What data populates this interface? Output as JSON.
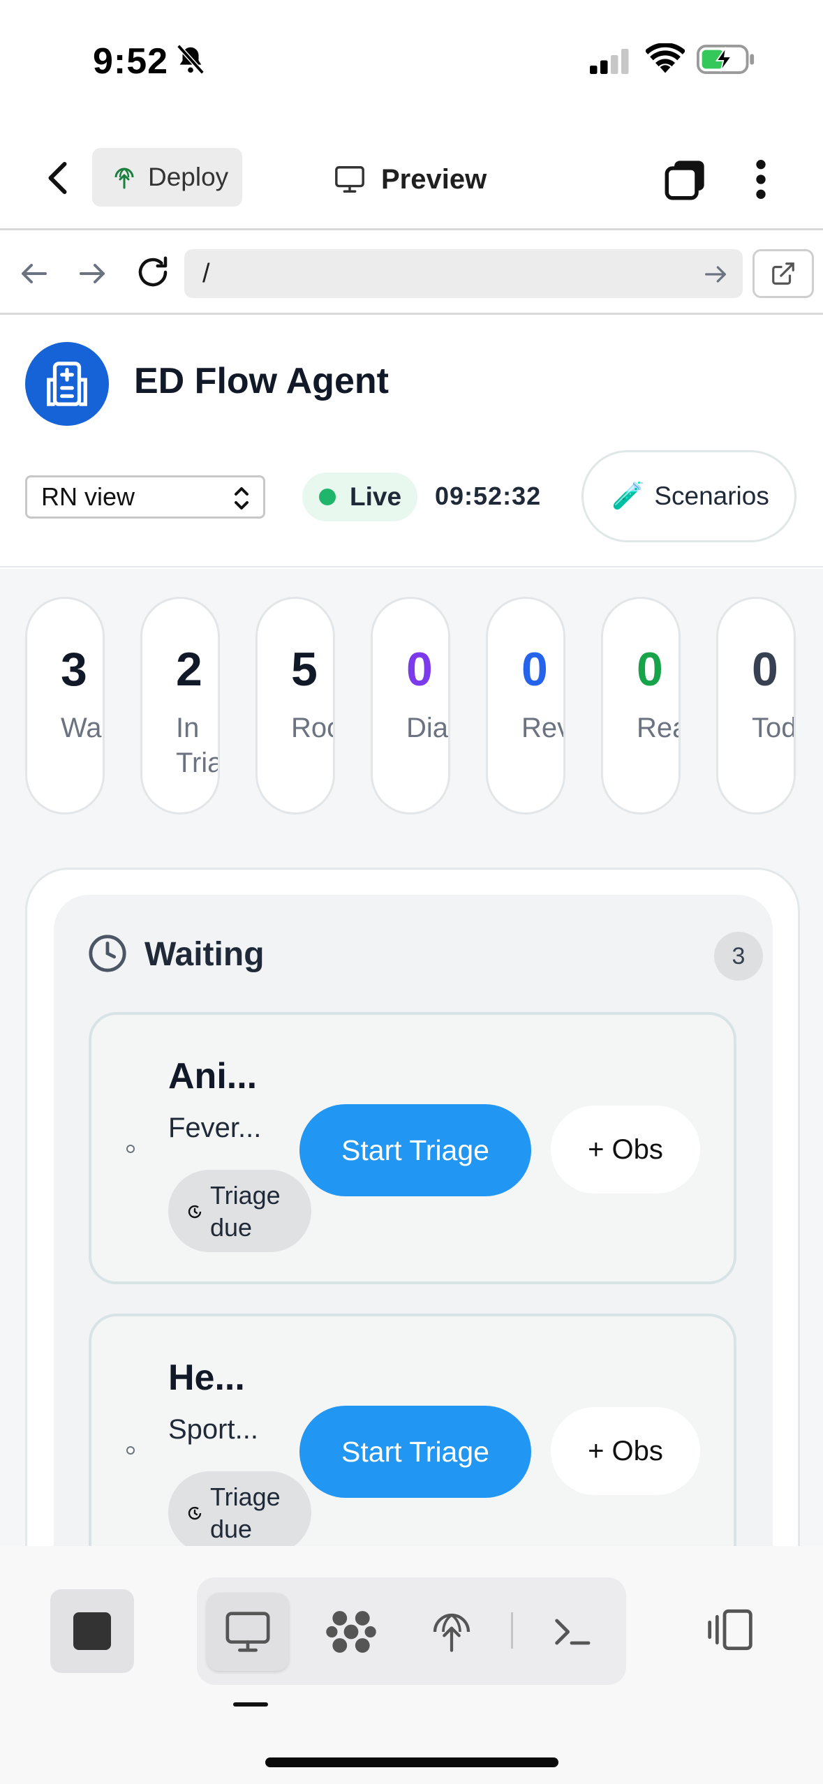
{
  "status_bar": {
    "time": "9:52"
  },
  "header": {
    "deploy_label": "Deploy",
    "title": "Preview"
  },
  "browser": {
    "url": "/"
  },
  "app": {
    "name": "ED Flow Agent",
    "role_select": "RN view",
    "live_label": "Live",
    "clock": "09:52:32",
    "scenarios_label": "Scenarios",
    "scenarios_emoji": "🧪"
  },
  "stats": [
    {
      "value": "3",
      "label": "Waiting",
      "color": "#111827"
    },
    {
      "value": "2",
      "label": "In Triage",
      "color": "#111827"
    },
    {
      "value": "5",
      "label": "Rooms",
      "color": "#111827"
    },
    {
      "value": "0",
      "label": "Diagnostics",
      "color": "#7c3aed"
    },
    {
      "value": "0",
      "label": "Review",
      "color": "#2563eb"
    },
    {
      "value": "0",
      "label": "Ready",
      "color": "#16a34a"
    },
    {
      "value": "0",
      "label": "Today",
      "color": "#374151"
    }
  ],
  "column": {
    "title": "Waiting",
    "count": "3",
    "patients": [
      {
        "name": "Ani...",
        "complaint": "Fever...",
        "badge": "Triage due",
        "primary_action": "Start Triage",
        "secondary_action": "+ Obs"
      },
      {
        "name": "He...",
        "complaint": "Sport...",
        "badge": "Triage due",
        "primary_action": "Start Triage",
        "secondary_action": "+ Obs"
      }
    ]
  },
  "colors": {
    "accent": "#2196f3",
    "logo": "#1563d6",
    "live": "#1fb56a"
  }
}
